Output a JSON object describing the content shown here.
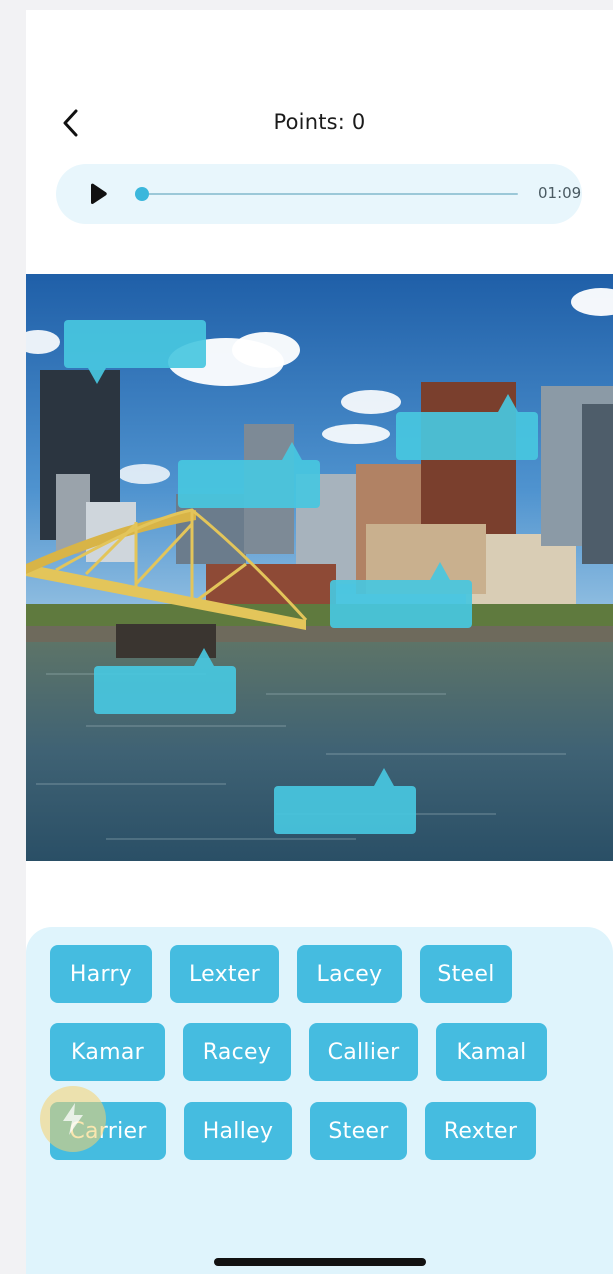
{
  "header": {
    "points_label": "Points: 0"
  },
  "player": {
    "time": "01:09",
    "progress": 0.0
  },
  "scene": {
    "description_icon": "city-river-bridge-photo"
  },
  "word_bank": {
    "words": [
      "Harry",
      "Lexter",
      "Lacey",
      "Steel",
      "Kamar",
      "Racey",
      "Callier",
      "Kamal",
      "Carrier",
      "Halley",
      "Steer",
      "Rexter"
    ]
  },
  "icons": {
    "back": "chevron-left-icon",
    "play": "play-icon",
    "hint": "lightning-bolt-icon"
  },
  "colors": {
    "accent": "#45bce0",
    "bubble": "#48c7df",
    "player_bg": "#e8f6fc",
    "bank_bg": "#dff4fc"
  }
}
